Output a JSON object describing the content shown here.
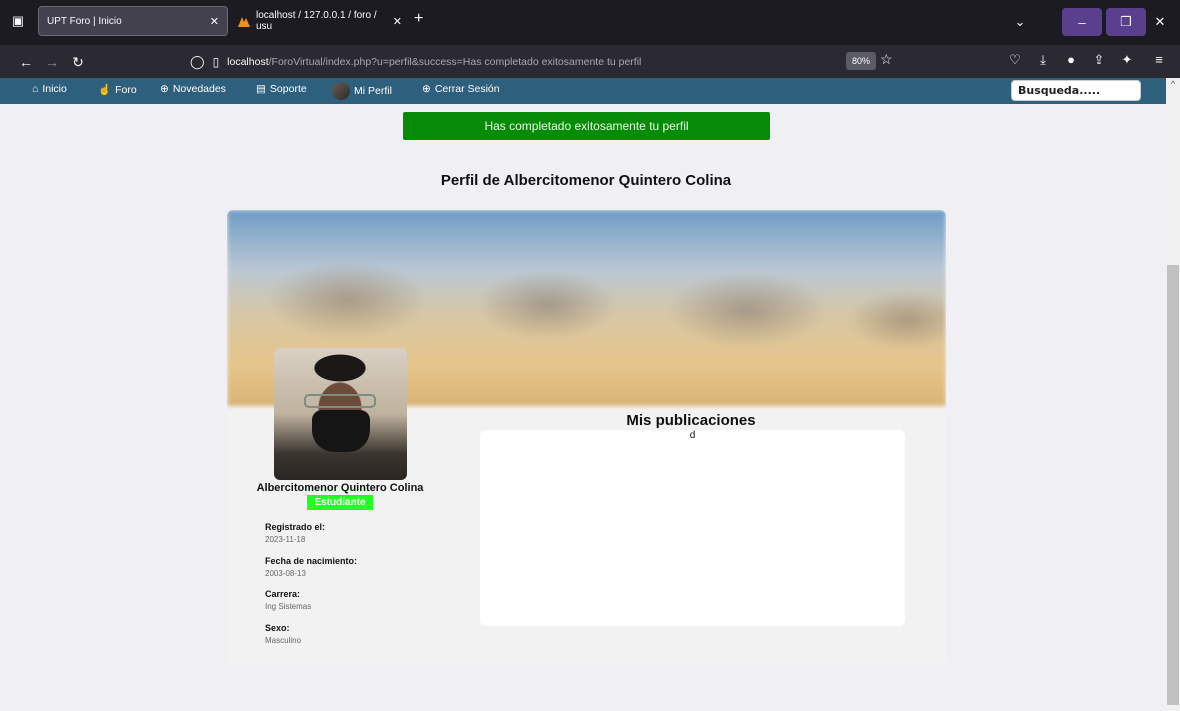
{
  "browser": {
    "tabs": [
      {
        "title": "UPT Foro | Inicio",
        "active": true
      },
      {
        "title": "localhost / 127.0.0.1 / foro / usu",
        "active": false
      }
    ],
    "url_host": "localhost",
    "url_rest": "/ForoVirtual/index.php?u=perfil&success=Has completado exitosamente tu perfil",
    "zoom": "80%"
  },
  "sitenav": {
    "items": [
      {
        "label": "Inicio",
        "icon": "home-icon"
      },
      {
        "label": "Foro",
        "icon": "hand-icon"
      },
      {
        "label": "Novedades",
        "icon": "globe-icon"
      },
      {
        "label": "Soporte",
        "icon": "support-icon"
      },
      {
        "label": "Mi Perfil",
        "icon": "avatar"
      },
      {
        "label": "Cerrar Sesión",
        "icon": "globe-icon"
      }
    ],
    "search_placeholder": "Busqueda....."
  },
  "page": {
    "alert": "Has completado exitosamente tu perfil",
    "title": "Perfil de Albercitomenor Quintero Colina"
  },
  "profile": {
    "name": "Albercitomenor Quintero Colina",
    "role": "Estudiante",
    "fields": [
      {
        "label": "Registrado el:",
        "value": "2023-11-18"
      },
      {
        "label": "Fecha de nacimiento:",
        "value": "2003-08-13"
      },
      {
        "label": "Carrera:",
        "value": "Ing Sistemas"
      },
      {
        "label": "Sexo:",
        "value": "Masculino"
      }
    ]
  },
  "publications": {
    "title": "Mis publicaciones",
    "content": "d"
  },
  "colors": {
    "sitenav_bg": "#2e5f7d",
    "alert_bg": "#058b05",
    "badge_bg": "#22ff22"
  }
}
